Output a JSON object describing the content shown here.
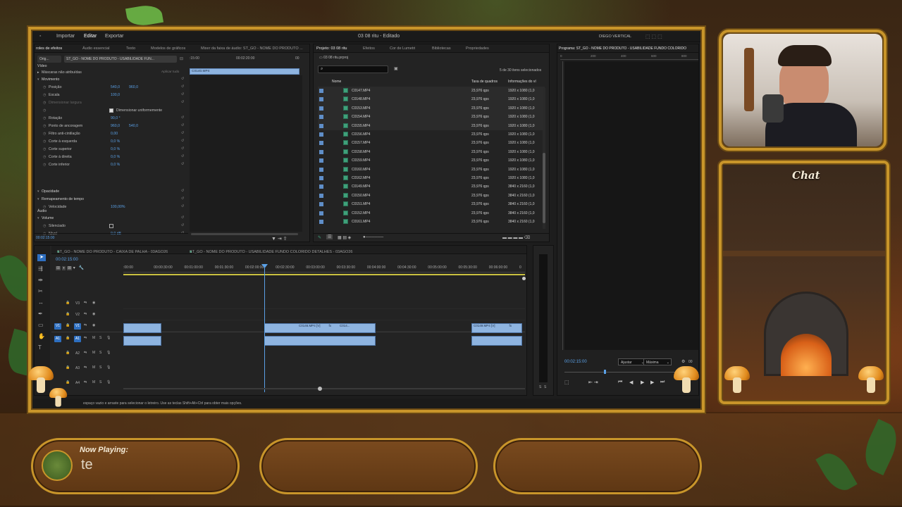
{
  "app": {
    "menu": [
      "Importar",
      "Editar",
      "Exportar"
    ],
    "active_menu": "Editar",
    "project_title": "03 08 ritu - Editado",
    "workspace": "DIEGO VERTICAL"
  },
  "effect_controls": {
    "tabs": [
      "roles de efeitos",
      "Áudio essencial",
      "Texto",
      "Modelos de gráficos",
      "Mixer da faixa de áudio: ST_GO - NOME DO PRODUTO ..."
    ],
    "source_label": "Orig...",
    "sequence_label": "ST_GO - NOME DO PRODUTO - USABILIDADE FUN...",
    "ruler_start": ":15:00",
    "ruler_mid": "00:02:20:00",
    "ruler_end": "00",
    "clip_name": "C0140.MP4",
    "section_video": "Vídeo",
    "masks": "Máscaras não atribuídas",
    "apply_all": "Aplicar tudo",
    "rows": [
      {
        "label": "Movimento",
        "type": "section"
      },
      {
        "label": "Posição",
        "v1": "540,0",
        "v2": "960,0"
      },
      {
        "label": "Escala",
        "v1": "100,0",
        "v2": ""
      },
      {
        "label": "Dimensionar largura",
        "v1": "",
        "v2": "",
        "dim": true
      },
      {
        "label": "Dimensionar uniformemente",
        "v1": "",
        "v2": "",
        "check": true
      },
      {
        "label": "Rotação",
        "v1": "90,0 °",
        "v2": ""
      },
      {
        "label": "Ponto de ancoragem",
        "v1": "960,0",
        "v2": "540,0"
      },
      {
        "label": "Filtro anti-cintilação",
        "v1": "0,00",
        "v2": ""
      },
      {
        "label": "Corte à esquerda",
        "v1": "0,0 %",
        "v2": ""
      },
      {
        "label": "Corte superior",
        "v1": "0,0 %",
        "v2": ""
      },
      {
        "label": "Corte à direita",
        "v1": "0,0 %",
        "v2": ""
      },
      {
        "label": "Corte inferior",
        "v1": "0,0 %",
        "v2": ""
      },
      {
        "label": "Opacidade",
        "type": "section"
      },
      {
        "label": "Remapeamento de tempo",
        "type": "section"
      },
      {
        "label": "Velocidade",
        "v1": "100,00%",
        "v2": ""
      }
    ],
    "section_audio": "Áudio",
    "audio_rows": [
      {
        "label": "Volume",
        "type": "section"
      },
      {
        "label": "Silenciado",
        "v1": "",
        "check": true
      },
      {
        "label": "Nível",
        "v1": "0,0 dB"
      }
    ],
    "timecode": "00:02:15:00"
  },
  "project": {
    "tabs": [
      "Projeto: 03 08 ritu",
      "Efeitos",
      "Cor de Lumetri",
      "Bibliotecas",
      "Propriedades"
    ],
    "path": "03 08 ritu.prproj",
    "selection": "5 de 30 itens selecionados",
    "columns": [
      "Nome",
      "Taxa de quadros",
      "Informações do ví"
    ],
    "rows": [
      {
        "name": "C0147.MP4",
        "fps": "23,976 qps",
        "res": "1920 x 1080 (1,0"
      },
      {
        "name": "C0148.MP4",
        "fps": "23,976 qps",
        "res": "1920 x 1080 (1,0"
      },
      {
        "name": "C0153.MP4",
        "fps": "23,976 qps",
        "res": "1920 x 1080 (1,0"
      },
      {
        "name": "C0154.MP4",
        "fps": "23,976 qps",
        "res": "1920 x 1080 (1,0"
      },
      {
        "name": "C0155.MP4",
        "fps": "23,976 qps",
        "res": "1920 x 1080 (1,0"
      },
      {
        "name": "C0156.MP4",
        "fps": "23,976 qps",
        "res": "1920 x 1080 (1,0"
      },
      {
        "name": "C0157.MP4",
        "fps": "23,976 qps",
        "res": "1920 x 1080 (1,0"
      },
      {
        "name": "C0158.MP4",
        "fps": "23,976 qps",
        "res": "1920 x 1080 (1,0"
      },
      {
        "name": "C0159.MP4",
        "fps": "23,976 qps",
        "res": "1920 x 1080 (1,0"
      },
      {
        "name": "C0160.MP4",
        "fps": "23,976 qps",
        "res": "1920 x 1080 (1,0"
      },
      {
        "name": "C0162.MP4",
        "fps": "23,976 qps",
        "res": "1920 x 1080 (1,0"
      },
      {
        "name": "C0149.MP4",
        "fps": "23,976 qps",
        "res": "3840 x 2160 (1,0"
      },
      {
        "name": "C0150.MP4",
        "fps": "23,976 qps",
        "res": "3840 x 2160 (1,0"
      },
      {
        "name": "C0151.MP4",
        "fps": "23,976 qps",
        "res": "3840 x 2160 (1,0"
      },
      {
        "name": "C0152.MP4",
        "fps": "23,976 qps",
        "res": "3840 x 2160 (1,0"
      },
      {
        "name": "C0161.MP4",
        "fps": "23,976 qps",
        "res": "3840 x 2160 (1,0"
      }
    ]
  },
  "program": {
    "title": "Programa: ST_GO - NOME DO PRODUTO - USABILIDADE FUNDO COLORIDO",
    "ruler": [
      "0",
      "200",
      "400",
      "600",
      "800"
    ],
    "timecode": "00:02:15:00",
    "fit": "Ajustar",
    "quality": "Máxima",
    "extra": "00"
  },
  "timeline": {
    "tabs": [
      "ST_GO - NOME DO PRODUTO - CAIXA DE PALHA - 03AGO26",
      "ST_GO - NOME DO PRODUTO - USABILIDADE FUNDO COLORIDO DETALHES - 03AGO26"
    ],
    "timecode": "00:02:15:00",
    "ruler": [
      ":00:00",
      "00:00:30:00",
      "00:01:00:00",
      "00:01:30:00",
      "00:02:00:00",
      "00:02:30:00",
      "00:03:00:00",
      "00:03:30:00",
      "00:04:00:00",
      "00:04:30:00",
      "00:05:00:00",
      "00:05:30:00",
      "00:06:00:00",
      "0"
    ],
    "video_tracks": [
      "V3",
      "V2",
      "V1"
    ],
    "audio_tracks": [
      "A1",
      "A2",
      "A3",
      "A4"
    ],
    "clip_labels": [
      "C0146.MP4 [V]",
      "fx",
      "C014...",
      "C0149.MP4 [V]",
      "fx"
    ],
    "meter_labels": [
      "S",
      "S"
    ]
  },
  "status_bar": "espaço vazio e arraste para selecionar o letreiro. Use as teclas Shift+Alt+Ctrl para obter mais opções.",
  "overlay": {
    "chat_label": "Chat",
    "now_playing_label": "Now Playing:",
    "now_playing_text": "te"
  }
}
